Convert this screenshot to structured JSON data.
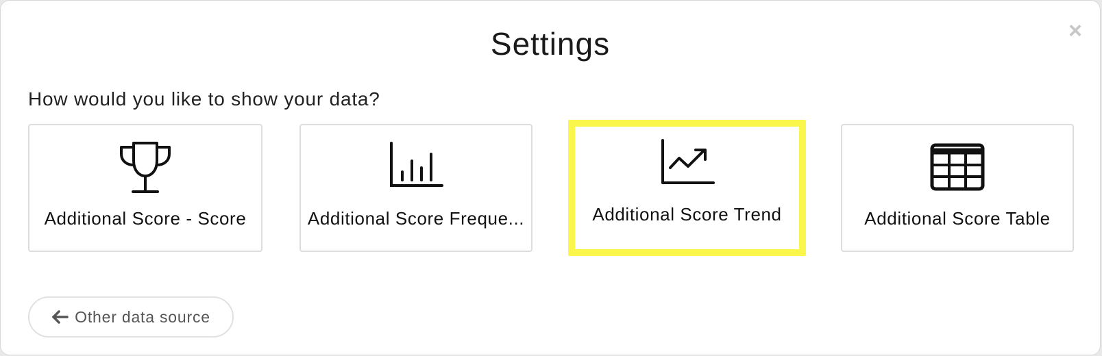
{
  "dialog": {
    "title": "Settings",
    "close_glyph": "×",
    "question": "How would you like to show your data?"
  },
  "options": [
    {
      "label": "Additional Score - Score",
      "icon": "trophy-icon",
      "selected": false
    },
    {
      "label": "Additional Score Freque...",
      "icon": "bar-chart-icon",
      "selected": false
    },
    {
      "label": "Additional Score Trend",
      "icon": "trend-chart-icon",
      "selected": true
    },
    {
      "label": "Additional Score Table",
      "icon": "table-icon",
      "selected": false
    }
  ],
  "footer": {
    "back_label": "Other data source",
    "back_icon": "arrow-left-icon"
  },
  "colors": {
    "highlight": "#fbf64c",
    "card_border": "#dddddd",
    "icon": "#111111"
  }
}
